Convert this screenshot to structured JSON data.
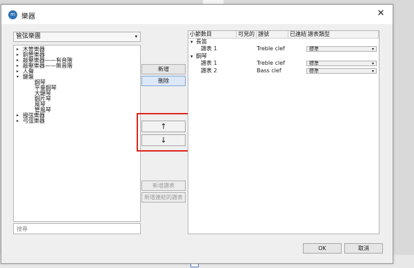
{
  "window": {
    "title": "樂器",
    "close_glyph": "✕",
    "logo_text": "m"
  },
  "left_panel": {
    "family_select": "管弦樂團",
    "tree": [
      {
        "label": "木管樂器",
        "expander": "▸",
        "depth": 0
      },
      {
        "label": "銅管樂器",
        "expander": "▸",
        "depth": 0
      },
      {
        "label": "敲擊樂器——有音階",
        "expander": "▸",
        "depth": 0
      },
      {
        "label": "敲擊樂器——無音階",
        "expander": "▸",
        "depth": 0
      },
      {
        "label": "人聲",
        "expander": "▸",
        "depth": 0
      },
      {
        "label": "鍵盤",
        "expander": "▾",
        "depth": 0
      },
      {
        "label": "鋼琴",
        "expander": "",
        "depth": 1
      },
      {
        "label": "平臺鋼琴",
        "expander": "",
        "depth": 1
      },
      {
        "label": "大鍵琴",
        "expander": "",
        "depth": 1
      },
      {
        "label": "鋼片琴",
        "expander": "",
        "depth": 1
      },
      {
        "label": "風琴",
        "expander": "",
        "depth": 1
      },
      {
        "label": "管風琴",
        "expander": "",
        "depth": 1
      },
      {
        "label": "撥弦樂器",
        "expander": "▸",
        "depth": 0
      },
      {
        "label": "弓弦樂器",
        "expander": "▸",
        "depth": 0
      }
    ],
    "search_placeholder": "搜尋"
  },
  "middle_buttons": {
    "add": "新增",
    "remove": "刪除",
    "move_up": "↑",
    "move_down": "↓",
    "add_staff": "新增譜表",
    "add_linked_staff": "新增連結的譜表"
  },
  "staff_table": {
    "headers": [
      "小節數目",
      "可見的",
      "譜號",
      "已連結",
      "譜表類型"
    ],
    "groups": [
      {
        "name": "長笛",
        "expander": "▾",
        "staves": [
          {
            "name": "譜表 1",
            "clef": "Treble clef",
            "type": "標準"
          }
        ]
      },
      {
        "name": "鋼琴",
        "expander": "▾",
        "staves": [
          {
            "name": "譜表 1",
            "clef": "Treble clef",
            "type": "標準"
          },
          {
            "name": "譜表 2",
            "clef": "Bass clef",
            "type": "標準"
          }
        ]
      }
    ],
    "dropdown_caret": "▾"
  },
  "footer": {
    "ok": "OK",
    "cancel": "取消"
  },
  "colors": {
    "highlight_border": "#e0211b",
    "accent": "#2e6fb5"
  }
}
